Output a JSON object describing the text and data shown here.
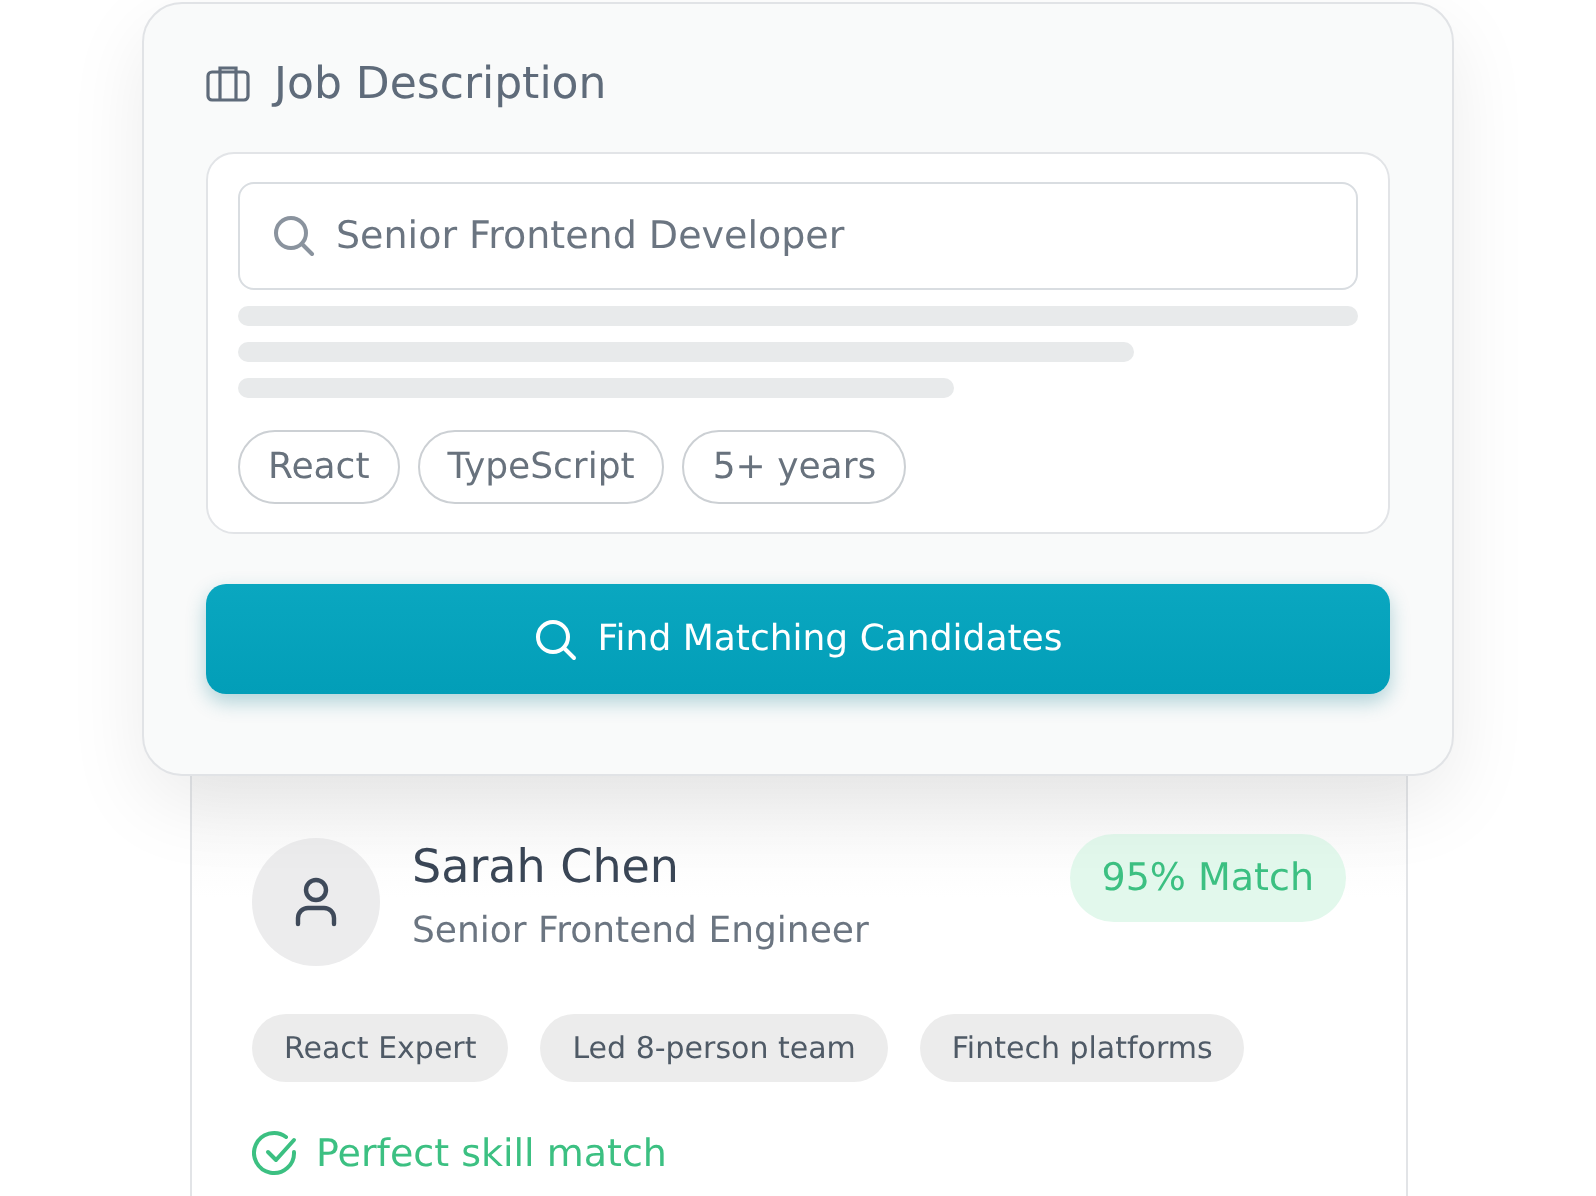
{
  "job_panel": {
    "title": "Job Description",
    "search": {
      "value": "Senior Frontend Developer"
    },
    "tags": [
      "React",
      "TypeScript",
      "5+ years"
    ],
    "button": "Find Matching Candidates"
  },
  "candidate": {
    "name": "Sarah Chen",
    "role": "Senior Frontend Engineer",
    "match": "95% Match",
    "highlights": [
      "React Expert",
      "Led 8-person team",
      "Fintech platforms"
    ],
    "note": "Perfect skill match"
  }
}
